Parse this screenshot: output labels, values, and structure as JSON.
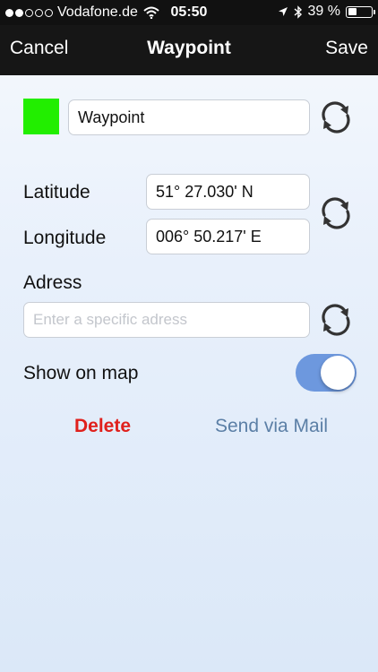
{
  "status_bar": {
    "carrier": "Vodafone.de",
    "time": "05:50",
    "battery": "39 %",
    "battery_level": 0.39,
    "signal_strength": 2,
    "signal_max": 5
  },
  "nav": {
    "cancel_label": "Cancel",
    "title": "Waypoint",
    "save_label": "Save"
  },
  "waypoint": {
    "name_value": "Waypoint",
    "color": "#22ee00"
  },
  "coordinates": {
    "latitude_label": "Latitude",
    "latitude_value": "51° 27.030' N",
    "longitude_label": "Longitude",
    "longitude_value": "006° 50.217' E"
  },
  "address": {
    "label": "Adress",
    "placeholder": "Enter a specific adress"
  },
  "show_on_map": {
    "label": "Show on map",
    "enabled": true,
    "toggle_color": "#6d98de"
  },
  "actions": {
    "delete_label": "Delete",
    "delete_color": "#e0201c",
    "mail_label": "Send via Mail",
    "mail_color": "#5b7fa6"
  }
}
